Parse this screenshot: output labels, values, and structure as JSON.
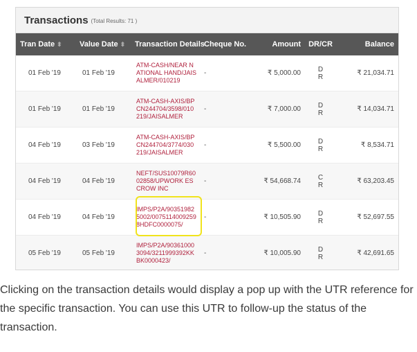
{
  "panel": {
    "title": "Transactions",
    "total_results": "(Total Results: 71 )"
  },
  "columns": {
    "tran_date": "Tran Date",
    "value_date": "Value Date",
    "details": "Transaction Details",
    "cheque": "Cheque No.",
    "amount": "Amount",
    "drcr": "DR/CR",
    "balance": "Balance"
  },
  "rows": [
    {
      "tran_date": "01 Feb '19",
      "value_date": "01 Feb '19",
      "details": "ATM-CASH/NEAR NATIONAL HAND/JAISALMER/010219",
      "cheque": "-",
      "amount": "₹ 5,000.00",
      "drcr": "DR",
      "balance": "₹ 21,034.71"
    },
    {
      "tran_date": "01 Feb '19",
      "value_date": "01 Feb '19",
      "details": "ATM-CASH-AXIS/BPCN244704/3598/010219/JAISALMER",
      "cheque": "-",
      "amount": "₹ 7,000.00",
      "drcr": "DR",
      "balance": "₹ 14,034.71"
    },
    {
      "tran_date": "04 Feb '19",
      "value_date": "03 Feb '19",
      "details": "ATM-CASH-AXIS/BPCN244704/3774/030219/JAISALMER",
      "cheque": "-",
      "amount": "₹ 5,500.00",
      "drcr": "DR",
      "balance": "₹ 8,534.71"
    },
    {
      "tran_date": "04 Feb '19",
      "value_date": "04 Feb '19",
      "details": "NEFT/SUS10079R6002858/UPWORK ESCROW INC",
      "cheque": "-",
      "amount": "₹ 54,668.74",
      "drcr": "CR",
      "balance": "₹ 63,203.45"
    },
    {
      "tran_date": "04 Feb '19",
      "value_date": "04 Feb '19",
      "details": "IMPS/P2A/903519825002/00751140092598HDFC0000075/",
      "cheque": "-",
      "amount": "₹ 10,505.90",
      "drcr": "DR",
      "balance": "₹ 52,697.55"
    },
    {
      "tran_date": "05 Feb '19",
      "value_date": "05 Feb '19",
      "details": "IMPS/P2A/903610003094/3211999392KKBK0000423/",
      "cheque": "-",
      "amount": "₹ 10,005.90",
      "drcr": "DR",
      "balance": "₹ 42,691.65"
    }
  ],
  "caption": "Clicking on the transaction details would display a pop up with the UTR reference for the specific transaction. You can use this UTR to follow-up the status of the transaction.",
  "colors": {
    "header_bg": "#575757",
    "details_text": "#b0213d",
    "highlight": "#f0e31c"
  }
}
